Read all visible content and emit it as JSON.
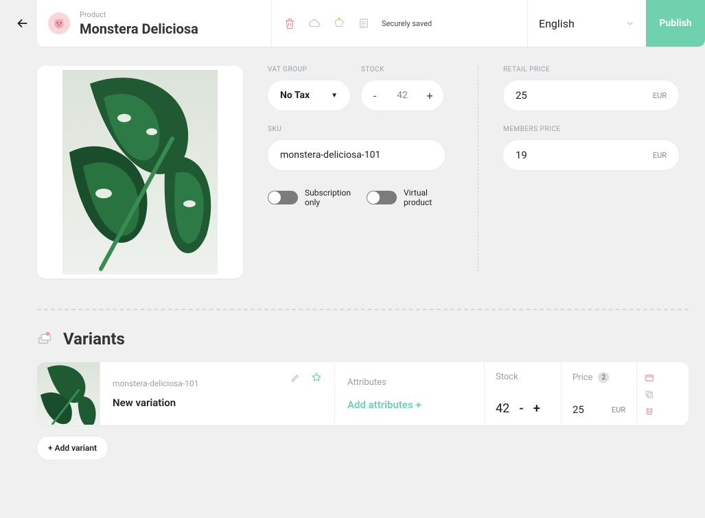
{
  "header": {
    "subtitle": "Product",
    "title": "Monstera Deliciosa",
    "saved_text": "Securely saved",
    "language": "English",
    "publish_label": "Publish"
  },
  "fields": {
    "vat_group_label": "VAT GROUP",
    "vat_group_value": "No Tax",
    "stock_label": "STOCK",
    "stock_value": "42",
    "sku_label": "SKU",
    "sku_value": "monstera-deliciosa-101",
    "subscription_label": "Subscription only",
    "virtual_label": "Virtual product",
    "retail_label": "RETAIL PRICE",
    "retail_value": "25",
    "retail_currency": "EUR",
    "members_label": "MEMBERS PRICE",
    "members_value": "19",
    "members_currency": "EUR"
  },
  "variants": {
    "heading": "Variants",
    "add_button": "+ Add variant",
    "items": [
      {
        "sku": "monstera-deliciosa-101",
        "name": "New variation",
        "attr_label": "Attributes",
        "attr_add": "Add attributes +",
        "stock_label": "Stock",
        "stock_value": "42",
        "price_label": "Price",
        "price_badge": "2",
        "price_value": "25",
        "price_currency": "EUR"
      }
    ]
  }
}
